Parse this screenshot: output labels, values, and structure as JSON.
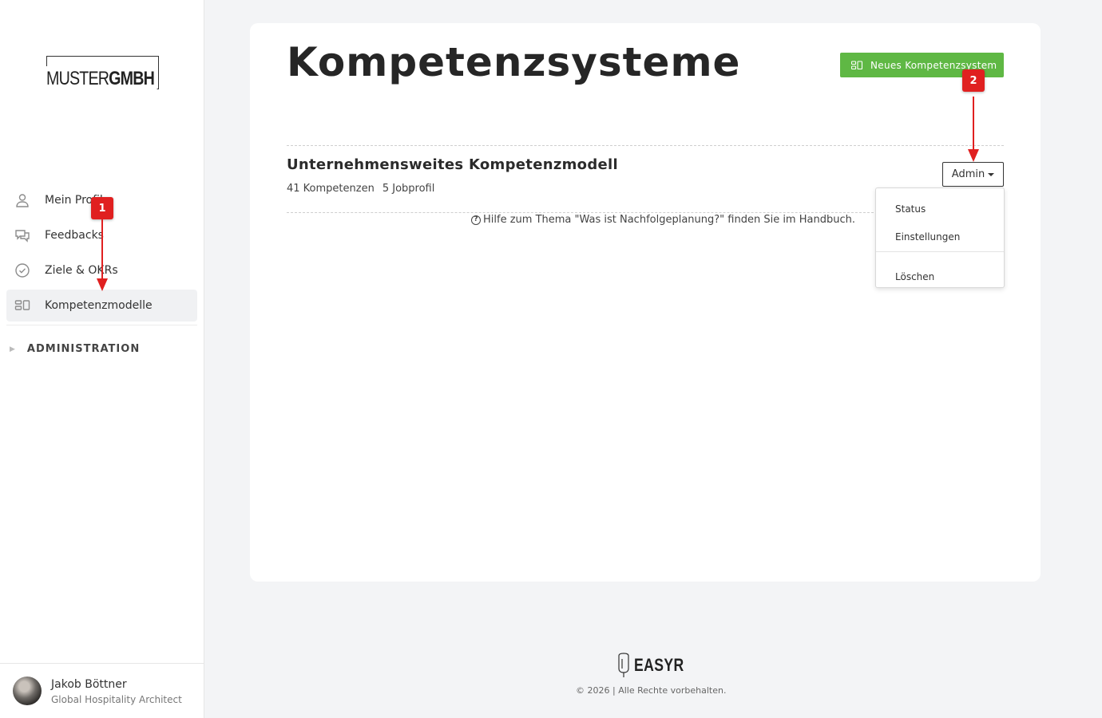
{
  "sidebar": {
    "logo": {
      "part1": "MUSTER",
      "part2": "GMBH"
    },
    "items": [
      {
        "label": "Mein Profil",
        "icon": "user-icon"
      },
      {
        "label": "Feedbacks",
        "icon": "chat-icon"
      },
      {
        "label": "Ziele & OKRs",
        "icon": "check-circle-icon"
      },
      {
        "label": "Kompetenzmodelle",
        "icon": "grid-icon",
        "active": true
      }
    ],
    "section": "ADMINISTRATION",
    "user": {
      "name": "Jakob Böttner",
      "role": "Global Hospitality Architect"
    }
  },
  "main": {
    "title": "Kompetenzsysteme",
    "new_button": "Neues Kompetenzsystem",
    "model": {
      "title": "Unternehmensweites Kompetenzmodell",
      "competencies": "41 Kompetenzen",
      "jobprofiles": "5 Jobprofil"
    },
    "help_text": "Hilfe zum Thema \"Was ist Nachfolgeplanung?\" finden Sie im Handbuch.",
    "admin_button": "Admin",
    "dropdown": [
      "Status",
      "Einstellungen",
      "Löschen"
    ]
  },
  "footer": {
    "brand": "EASYR",
    "copyright": "© 2026 | Alle Rechte vorbehalten."
  },
  "annotations": {
    "badge1": "1",
    "badge2": "2"
  },
  "colors": {
    "accent": "#5fb844",
    "annotation": "#e02020",
    "background": "#f3f4f6"
  }
}
